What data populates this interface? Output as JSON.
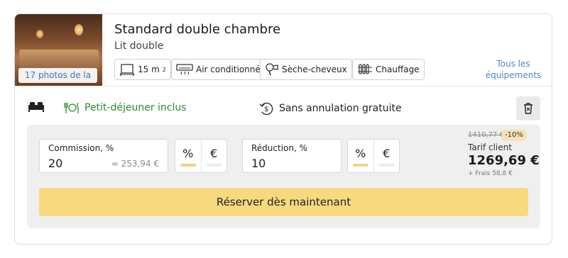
{
  "room": {
    "photo_label": "17 photos de la",
    "title": "Standard double chambre",
    "subtitle": "Lit double",
    "amenities": [
      {
        "icon": "area-icon",
        "label": "15 m",
        "sup": "2"
      },
      {
        "icon": "air-conditioner-icon",
        "label": "Air conditionné"
      },
      {
        "icon": "hair-dryer-icon",
        "label": "Sèche-cheveux"
      },
      {
        "icon": "radiator-icon",
        "label": "Chauffage"
      }
    ],
    "all_equipment_link": "Tous les équipements"
  },
  "features": {
    "breakfast": "Petit-déjeuner inclus",
    "cancellation": "Sans annulation gratuite"
  },
  "booking": {
    "commission": {
      "label": "Commission, %",
      "value": "20",
      "approx": "≈ 253,94 €"
    },
    "commission_toggle": {
      "options": [
        "%",
        "€"
      ],
      "selected": "%"
    },
    "reduction": {
      "label": "Réduction, %",
      "value": "10"
    },
    "reduction_toggle": {
      "options": [
        "%",
        "€"
      ],
      "selected": "%"
    },
    "old_price": "1410,77 €",
    "discount_badge": "-10%",
    "price_label": "Tarif client",
    "price": "1269,69 €",
    "fees": "+ Frais 58,8 €",
    "reserve_button": "Réserver dès maintenant"
  },
  "colors": {
    "accent": "#f7d97f",
    "link": "#4a86d0",
    "breakfast_green": "#2e8b33"
  }
}
